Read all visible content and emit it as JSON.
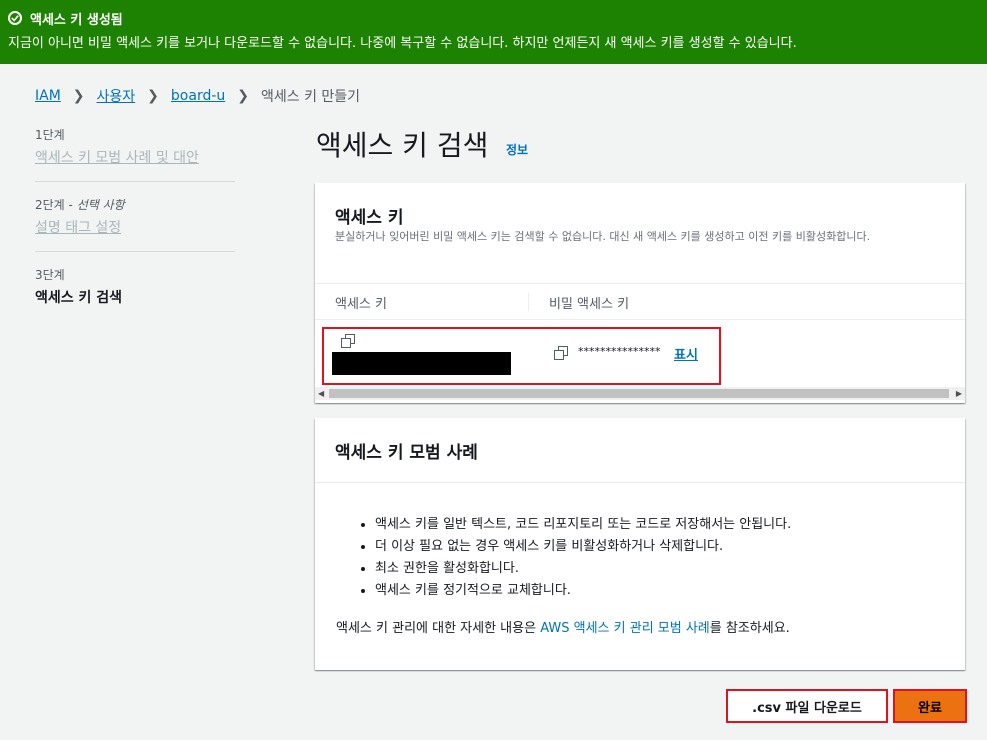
{
  "banner": {
    "title": "액세스 키 생성됨",
    "message": "지금이 아니면 비밀 액세스 키를 보거나 다운로드할 수 없습니다. 나중에 복구할 수 없습니다. 하지만 언제든지 새 액세스 키를 생성할 수 있습니다.",
    "color": "#1d8102"
  },
  "breadcrumb": {
    "items": [
      "IAM",
      "사용자",
      "board-u"
    ],
    "current": "액세스 키 만들기"
  },
  "steps": [
    {
      "num": "1단계",
      "label": "액세스 키 모범 사례 및 대안"
    },
    {
      "num": "2단계",
      "optional": "선택 사항",
      "label": "설명 태그 설정"
    },
    {
      "num": "3단계",
      "label": "액세스 키 검색"
    }
  ],
  "page": {
    "title": "액세스 키 검색",
    "info": "정보"
  },
  "access_key_card": {
    "title": "액세스 키",
    "description": "분실하거나 잊어버린 비밀 액세스 키는 검색할 수 없습니다. 대신 새 액세스 키를 생성하고 이전 키를 비활성화합니다.",
    "columns": [
      "액세스 키",
      "비밀 액세스 키"
    ],
    "secret_mask": "***************",
    "show_label": "표시"
  },
  "best_practices_card": {
    "title": "액세스 키 모범 사례",
    "items": [
      "액세스 키를 일반 텍스트, 코드 리포지토리 또는 코드로 저장해서는 안됩니다.",
      "더 이상 필요 없는 경우 액세스 키를 비활성화하거나 삭제합니다.",
      "최소 권한을 활성화합니다.",
      "액세스 키를 정기적으로 교체합니다."
    ],
    "footer_prefix": "액세스 키 관리에 대한 자세한 내용은 ",
    "footer_link": "AWS 액세스 키 관리 모범 사례",
    "footer_suffix": "를 참조하세요."
  },
  "actions": {
    "download": ".csv 파일 다운로드",
    "done": "완료",
    "accent": "#ec7211"
  }
}
